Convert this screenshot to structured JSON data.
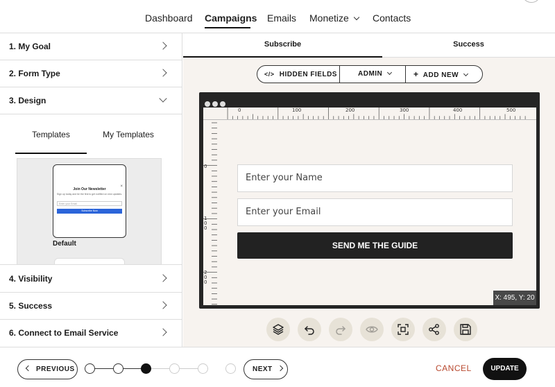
{
  "nav": {
    "items": [
      {
        "label": "Dashboard",
        "active": false
      },
      {
        "label": "Campaigns",
        "active": true
      },
      {
        "label": "Emails",
        "active": false
      },
      {
        "label": "Monetize",
        "active": false,
        "dropdown": true
      },
      {
        "label": "Contacts",
        "active": false
      }
    ]
  },
  "sidebar": {
    "steps": [
      {
        "label": "1. My Goal",
        "state": "collapsed"
      },
      {
        "label": "2. Form Type",
        "state": "collapsed"
      },
      {
        "label": "3. Design",
        "state": "expanded"
      },
      {
        "label": "4. Visibility",
        "state": "collapsed"
      },
      {
        "label": "5. Success",
        "state": "collapsed"
      },
      {
        "label": "6. Connect to Email Service",
        "state": "collapsed"
      }
    ],
    "design": {
      "tabs": [
        {
          "label": "Templates",
          "active": true
        },
        {
          "label": "My Templates",
          "active": false
        }
      ],
      "templates": [
        {
          "name": "Default",
          "preview_title": "Join Our Newsletter",
          "preview_text": "Sign up today and be the first to get notified on new updates.",
          "preview_input": "Enter your Email",
          "preview_button": "Subscribe Now",
          "preview_close": "×"
        }
      ]
    }
  },
  "main": {
    "tabs": [
      {
        "label": "Subscribe",
        "active": true
      },
      {
        "label": "Success",
        "active": false
      }
    ],
    "toolbar": {
      "hidden_fields": "HIDDEN FIELDS",
      "hidden_fields_icon": "</>",
      "role": "ADMIN",
      "add_new": "ADD NEW",
      "add_new_icon": "+"
    },
    "ruler": {
      "top_labels": [
        "0",
        "100",
        "200",
        "300",
        "400",
        "500"
      ],
      "left_labels": [
        "0",
        "100",
        "200"
      ]
    },
    "form": {
      "name_placeholder": "Enter your Name",
      "email_placeholder": "Enter your Email",
      "button_label": "SEND ME THE GUIDE"
    },
    "cursor_readout": "X: 495, Y: 20",
    "tools": [
      {
        "icon": "layers-icon",
        "enabled": true
      },
      {
        "icon": "undo-icon",
        "enabled": true
      },
      {
        "icon": "redo-icon",
        "enabled": false
      },
      {
        "icon": "preview-eye-icon",
        "enabled": false
      },
      {
        "icon": "fit-screen-icon",
        "enabled": true
      },
      {
        "icon": "share-icon",
        "enabled": true
      },
      {
        "icon": "save-icon",
        "enabled": true
      }
    ]
  },
  "footer": {
    "previous": "PREVIOUS",
    "next": "NEXT",
    "cancel": "CANCEL",
    "update": "UPDATE",
    "progress": {
      "total_steps": 6,
      "current_step": 3
    }
  },
  "colors": {
    "accent_dark": "#111111",
    "cancel_text": "#b8482e",
    "canvas_bg": "#f7f3ef",
    "tool_bg": "#e7e2d7",
    "template_button": "#2b64d9"
  }
}
